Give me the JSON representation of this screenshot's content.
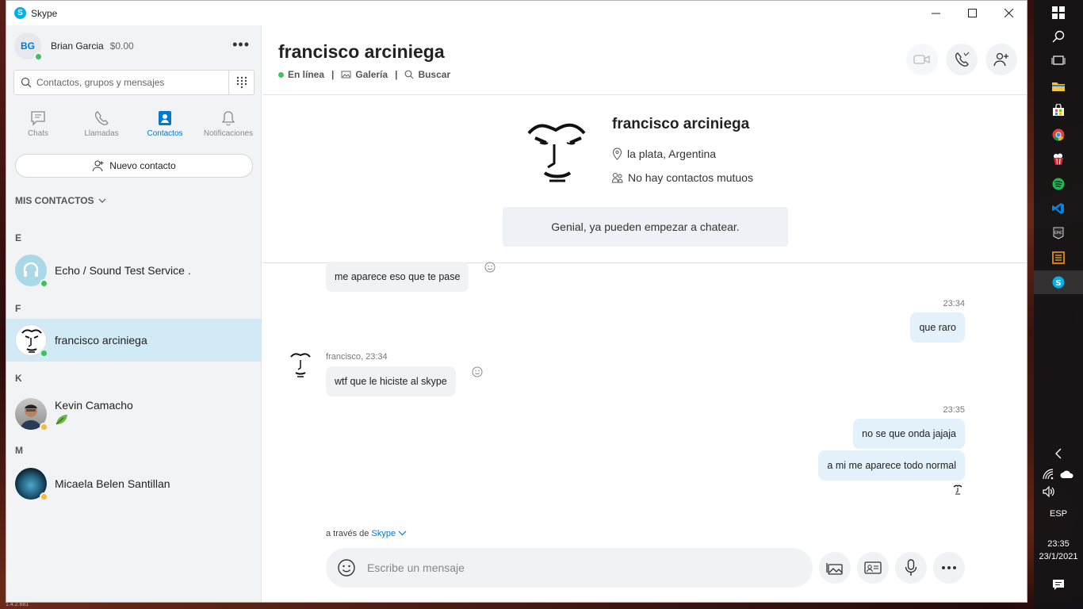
{
  "window": {
    "app_title": "Skype"
  },
  "profile": {
    "initials": "BG",
    "name": "Brian Garcia",
    "credit": "$0.00"
  },
  "search": {
    "placeholder": "Contactos, grupos y mensajes"
  },
  "nav_tabs": [
    {
      "label": "Chats",
      "icon": "chat-icon",
      "active": false
    },
    {
      "label": "Llamadas",
      "icon": "phone-icon",
      "active": false
    },
    {
      "label": "Contactos",
      "icon": "contacts-icon",
      "active": true
    },
    {
      "label": "Notificaciones",
      "icon": "bell-icon",
      "active": false
    }
  ],
  "new_contact_label": "Nuevo contacto",
  "contacts_header": "MIS CONTACTOS",
  "contact_groups": [
    {
      "letter": "E",
      "contacts": [
        {
          "name": "Echo / Sound Test Service .",
          "status": "online"
        }
      ]
    },
    {
      "letter": "F",
      "contacts": [
        {
          "name": "francisco arciniega",
          "status": "online",
          "active": true
        }
      ]
    },
    {
      "letter": "K",
      "contacts": [
        {
          "name": "Kevin Camacho",
          "status": "away",
          "mood_icon": "leaf-icon"
        }
      ]
    },
    {
      "letter": "M",
      "contacts": [
        {
          "name": "Micaela Belen Santillan",
          "status": "away"
        }
      ]
    }
  ],
  "chat": {
    "title": "francisco arciniega",
    "status": "En línea",
    "gallery": "Galería",
    "search": "Buscar"
  },
  "profile_card": {
    "name": "francisco arciniega",
    "location": "la plata, Argentina",
    "mutual": "No hay contactos mutuos",
    "greeting": "Genial, ya pueden empezar a chatear."
  },
  "messages": {
    "m1": "me aparece eso que te pase",
    "ts1": "23:34",
    "m2": "que raro",
    "sender2": "francisco, 23:34",
    "m3": "wtf que le hiciste al skype",
    "ts3": "23:35",
    "m4": "no se que onda jajaja",
    "m5": "a mi me aparece todo normal"
  },
  "via": {
    "prefix": "a través de",
    "link": "Skype"
  },
  "composer": {
    "placeholder": "Escribe un mensaje"
  },
  "taskbar": {
    "language": "ESP",
    "time": "23:35",
    "date": "23/1/2021"
  },
  "version": "1.4.2.681",
  "colors": {
    "accent": "#0078d4",
    "online": "#3ec15c",
    "away": "#f8b838",
    "selected": "#d1eaf6"
  }
}
